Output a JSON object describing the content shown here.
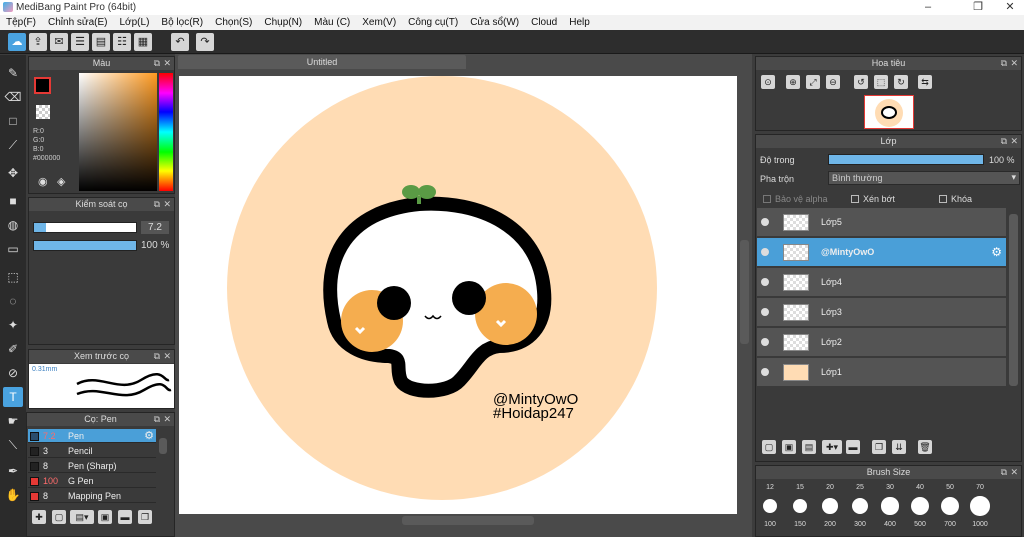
{
  "window": {
    "title": "MediBang Paint Pro (64bit)"
  },
  "menu": [
    "Tệp(F)",
    "Chỉnh sửa(E)",
    "Lớp(L)",
    "Bộ lọc(R)",
    "Chọn(S)",
    "Chụp(N)",
    "Màu (C)",
    "Xem(V)",
    "Công cụ(T)",
    "Cửa sổ(W)",
    "Cloud",
    "Help"
  ],
  "panels": {
    "color": {
      "title": "Màu",
      "r": "R:0",
      "g": "G:0",
      "b": "B:0",
      "hex": "#000000"
    },
    "brush_control": {
      "title": "Kiểm soát cọ",
      "size": "7.2",
      "opacity": "100 %"
    },
    "brush_preview": {
      "title": "Xem trước cọ",
      "size": "0.31mm"
    },
    "brush_list": {
      "title": "Cọ: Pen",
      "items": [
        {
          "size": "7.2",
          "name": "Pen",
          "color": "#000000"
        },
        {
          "size": "3",
          "name": "Pencil",
          "color": "#222222"
        },
        {
          "size": "8",
          "name": "Pen (Sharp)",
          "color": "#222222"
        },
        {
          "size": "100",
          "name": "G Pen",
          "color": "#e53935"
        },
        {
          "size": "8",
          "name": "Mapping Pen",
          "color": "#e53935"
        }
      ]
    },
    "navigator": {
      "title": "Hoa tiêu"
    },
    "layers": {
      "title": "Lớp",
      "opacity_label": "Độ trong",
      "opacity_value": "100 %",
      "blend_label": "Pha trộn",
      "blend_value": "Bình thường",
      "protect_alpha": "Bảo vệ alpha",
      "clipping": "Xén bớt",
      "lock": "Khóa",
      "items": [
        {
          "name": "Lớp5"
        },
        {
          "name": "@MintyOwO"
        },
        {
          "name": "Lớp4"
        },
        {
          "name": "Lớp3"
        },
        {
          "name": "Lớp2"
        },
        {
          "name": "Lớp1"
        }
      ]
    },
    "brush_size": {
      "title": "Brush Size",
      "top": [
        "12",
        "15",
        "20",
        "25",
        "30",
        "40",
        "50",
        "70"
      ],
      "bottom": [
        "100",
        "150",
        "200",
        "300",
        "400",
        "500",
        "700",
        "1000"
      ]
    }
  },
  "canvas": {
    "tab": "Untitled",
    "watermark_line1": "@MintyOwO",
    "watermark_line2": "#Hoidap247",
    "bg_color": "#ffdcb4",
    "blush_color": "#f5ad4f",
    "sprout_color": "#5a9b45"
  }
}
